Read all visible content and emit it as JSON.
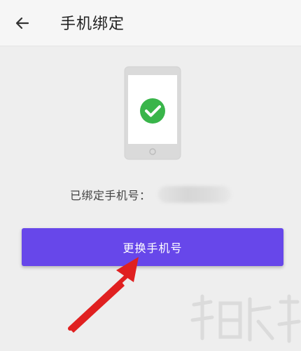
{
  "header": {
    "back_icon": "back-arrow-icon",
    "title": "手机绑定"
  },
  "illustration": {
    "phone_icon": "phone-icon",
    "check_icon": "check-circle-icon",
    "check_color": "#39b54a"
  },
  "binding": {
    "label": "已绑定手机号：",
    "phone_number_blurred": true
  },
  "actions": {
    "change_phone_label": "更换手机号",
    "accent_color": "#6747ea"
  },
  "annotation": {
    "arrow_icon": "red-arrow-icon",
    "arrow_color": "#e02020"
  }
}
